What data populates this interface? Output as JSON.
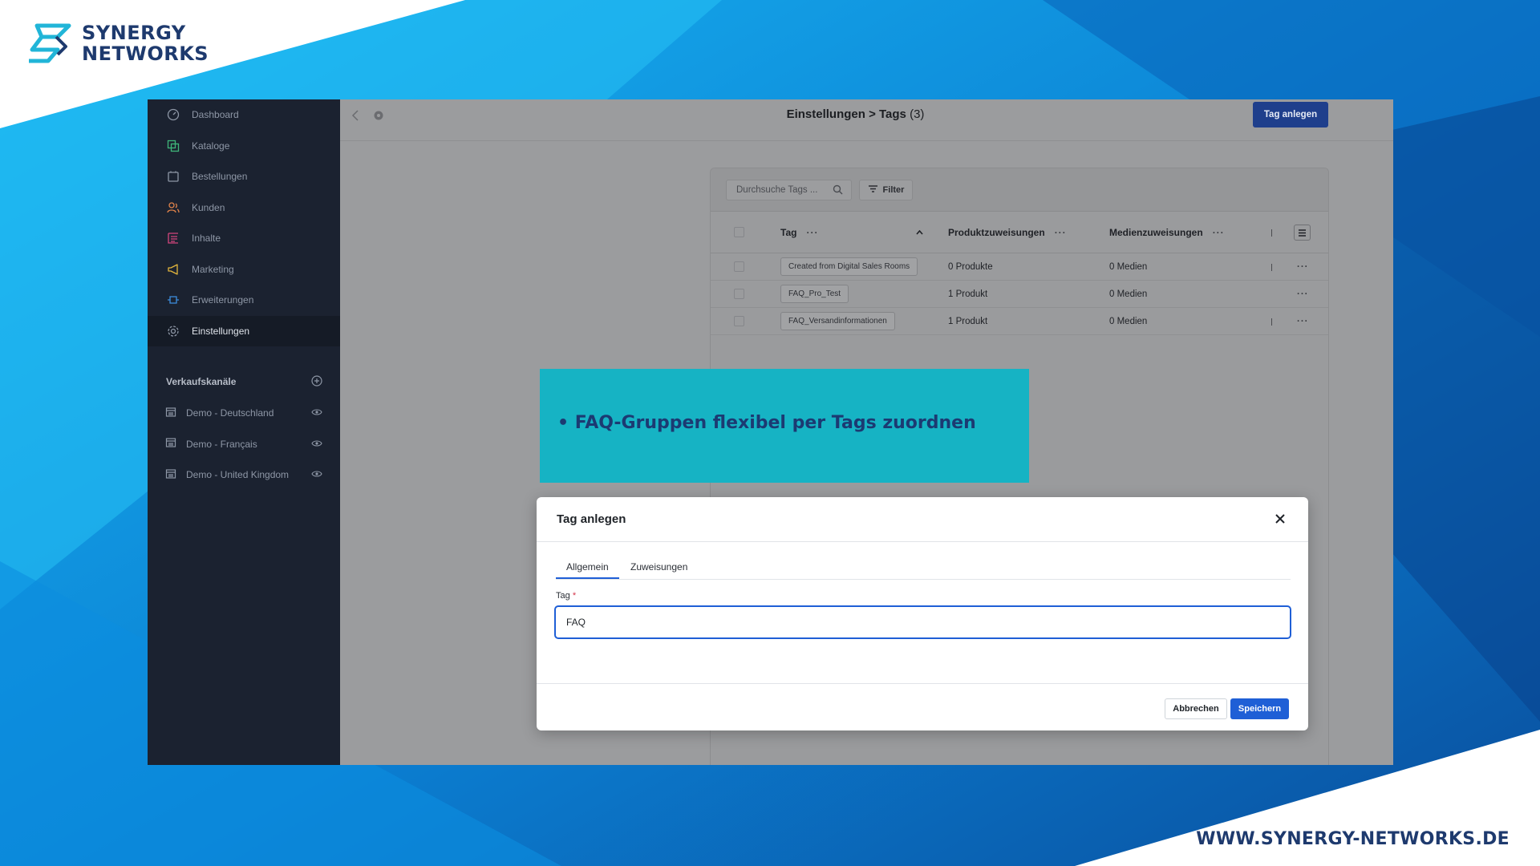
{
  "brand": {
    "line1": "SYNERGY",
    "line2": "NETWORKS",
    "website": "WWW.SYNERGY-NETWORKS.DE",
    "color": "#1e3a6e"
  },
  "sidebar": {
    "items": [
      {
        "label": "Dashboard",
        "icon": "dashboard-icon"
      },
      {
        "label": "Kataloge",
        "icon": "catalog-icon"
      },
      {
        "label": "Bestellungen",
        "icon": "orders-icon"
      },
      {
        "label": "Kunden",
        "icon": "customers-icon"
      },
      {
        "label": "Inhalte",
        "icon": "content-icon"
      },
      {
        "label": "Marketing",
        "icon": "megaphone-icon"
      },
      {
        "label": "Erweiterungen",
        "icon": "extensions-icon"
      },
      {
        "label": "Einstellungen",
        "icon": "gear-icon",
        "active": true
      }
    ],
    "sales_channels_title": "Verkaufskanäle",
    "channels": [
      {
        "label": "Demo - Deutschland"
      },
      {
        "label": "Demo - Français"
      },
      {
        "label": "Demo - United Kingdom"
      }
    ]
  },
  "header": {
    "title": "Einstellungen > Tags",
    "count": "(3)",
    "create_button": "Tag anlegen"
  },
  "list": {
    "search_placeholder": "Durchsuche Tags ...",
    "filter_label": "Filter",
    "columns": [
      "Tag",
      "Produktzuweisungen",
      "Medienzuweisungen"
    ],
    "rows": [
      {
        "tag": "Created from Digital Sales Rooms",
        "products": "0 Produkte",
        "media": "0 Medien"
      },
      {
        "tag": "FAQ_Pro_Test",
        "products": "1 Produkt",
        "media": "0 Medien"
      },
      {
        "tag": "FAQ_Versandinformationen",
        "products": "1 Produkt",
        "media": "0 Medien"
      }
    ]
  },
  "callout": {
    "text": "• FAQ-Gruppen flexibel per Tags zuordnen",
    "color": "#16b3c4"
  },
  "modal": {
    "title": "Tag anlegen",
    "tabs": [
      "Allgemein",
      "Zuweisungen"
    ],
    "field_label": "Tag",
    "field_required": "*",
    "field_value": "FAQ",
    "cancel_label": "Abbrechen",
    "save_label": "Speichern",
    "accent": "#1f5fd6"
  }
}
